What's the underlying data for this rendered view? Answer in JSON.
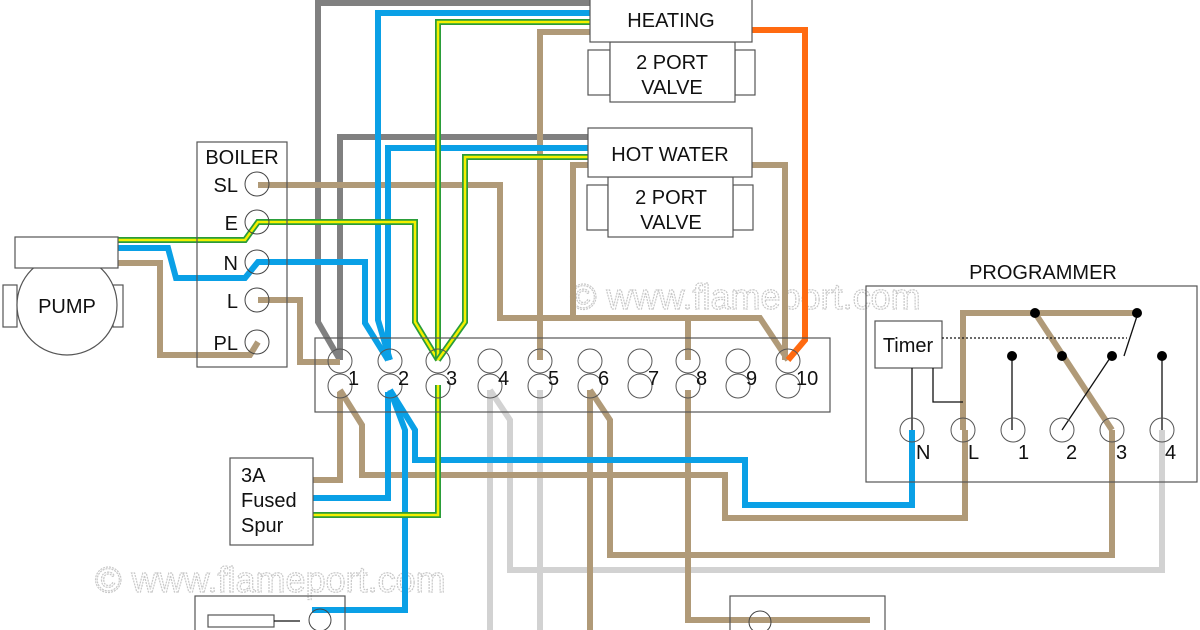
{
  "watermark": "© www.flameport.com",
  "heating": {
    "label": "HEATING",
    "valve_line1": "2 PORT",
    "valve_line2": "VALVE"
  },
  "hot_water": {
    "label": "HOT WATER",
    "valve_line1": "2 PORT",
    "valve_line2": "VALVE"
  },
  "boiler": {
    "title": "BOILER",
    "terminals": [
      "SL",
      "E",
      "N",
      "L",
      "PL"
    ]
  },
  "pump": {
    "label": "PUMP"
  },
  "junction_box": {
    "terminals": [
      "1",
      "2",
      "3",
      "4",
      "5",
      "6",
      "7",
      "8",
      "9",
      "10"
    ]
  },
  "fused_spur": {
    "line1": "3A",
    "line2": "Fused",
    "line3": "Spur"
  },
  "programmer": {
    "title": "PROGRAMMER",
    "timer": "Timer",
    "terminals": [
      "N",
      "L",
      "1",
      "2",
      "3",
      "4"
    ]
  },
  "colors": {
    "live_brown": "#b09a78",
    "neutral_blue": "#0aa0e6",
    "earth_green": "#2a9d3a",
    "earth_yellow": "#f4f000",
    "grey": "#808080",
    "light_grey": "#d2d2d2",
    "orange": "#ff6a10"
  }
}
